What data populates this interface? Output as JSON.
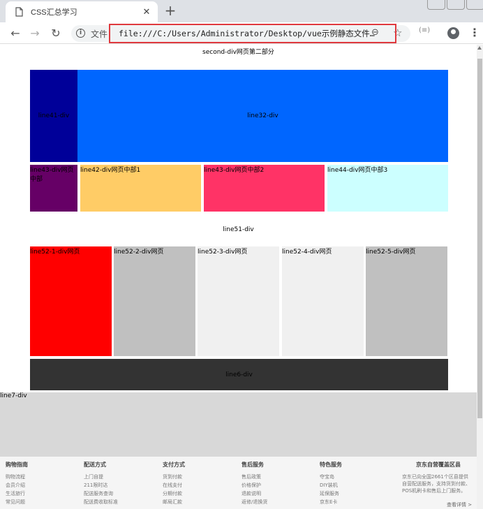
{
  "browser": {
    "tab_title": "CSS汇总学习",
    "tab_close": "✕",
    "new_tab": "+",
    "back": "←",
    "forward": "→",
    "reload": "↻",
    "info": "i",
    "file_label": "文件",
    "url": "file:///C:/Users/Administrator/Desktop/vue示例静态文件…",
    "zoom": "⊖",
    "star": "☆",
    "ext": "(≡)",
    "menu": "⋮"
  },
  "page": {
    "second_title": "second-div网页第二部分",
    "line41": "line41-div",
    "line32": "line32-div",
    "line43a": "line43-div网页中部",
    "line42": "line42-div网页中部1",
    "line43b": "line43-div网页中部2",
    "line44": "line44-div网页中部3",
    "line51": "line51-div",
    "line52_1": "line52-1-div网页",
    "line52_2": "line52-2-div网页",
    "line52_3": "line52-3-div网页",
    "line52_4": "line52-4-div网页",
    "line52_5": "line52-5-div网页",
    "line6": "line6-div",
    "line7": "line7-div"
  },
  "colors": {
    "dark_navy": "#000099",
    "blue": "#0066ff",
    "purple": "#660066",
    "orange": "#ffcc66",
    "pink": "#ff3366",
    "cyan": "#ccffff",
    "red": "#ff0000",
    "gray": "#c0c0c0",
    "light_gray": "#f0f0f0",
    "dark": "#333333",
    "line7_bg": "#d8d8d8"
  },
  "footer": {
    "columns": [
      {
        "heading": "购物指南",
        "items": [
          "购物流程",
          "会员介绍",
          "生活旅行",
          "常见问题"
        ]
      },
      {
        "heading": "配送方式",
        "items": [
          "上门自提",
          "211限时达",
          "配送服务查询",
          "配送费收取标准"
        ]
      },
      {
        "heading": "支付方式",
        "items": [
          "货到付款",
          "在线支付",
          "分期付款",
          "邮局汇款"
        ]
      },
      {
        "heading": "售后服务",
        "items": [
          "售后政策",
          "价格保护",
          "退款说明",
          "返修/退换货"
        ]
      },
      {
        "heading": "特色服务",
        "items": [
          "夺宝岛",
          "DIY装机",
          "延保服务",
          "京东E卡"
        ]
      }
    ],
    "right_heading": "京东自营覆盖区县",
    "right_text": "京东已向全国2661个区县提供自营配送服务，支持货到付款、POS机刷卡和售后上门服务。",
    "review": "查看详情 >"
  }
}
